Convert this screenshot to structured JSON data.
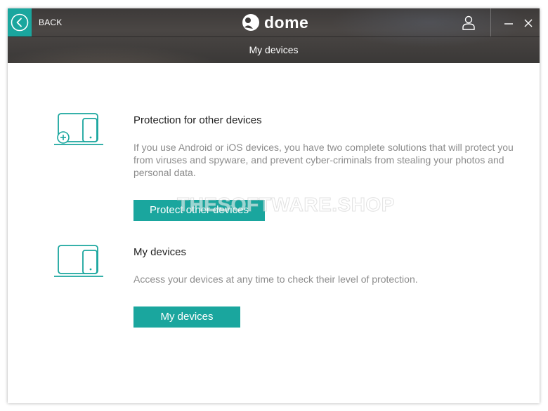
{
  "header": {
    "back_label": "BACK",
    "logo_text": "dome",
    "page_title": "My devices"
  },
  "sections": [
    {
      "title": "Protection for other devices",
      "description": "If you use Android or iOS devices, you have two complete solutions that will protect you from viruses and spyware, and prevent cyber-criminals from stealing your photos and personal data.",
      "button_label": "Protect other devices",
      "icon": "add-devices-icon"
    },
    {
      "title": "My devices",
      "description": "Access your devices at any time to check their level of protection.",
      "button_label": "My devices",
      "icon": "devices-icon"
    }
  ],
  "watermark": "THESOFTWARE.SHOP",
  "colors": {
    "accent": "#1aa69e",
    "title_text": "#1f1f1f",
    "body_text": "#8c8c8c"
  }
}
